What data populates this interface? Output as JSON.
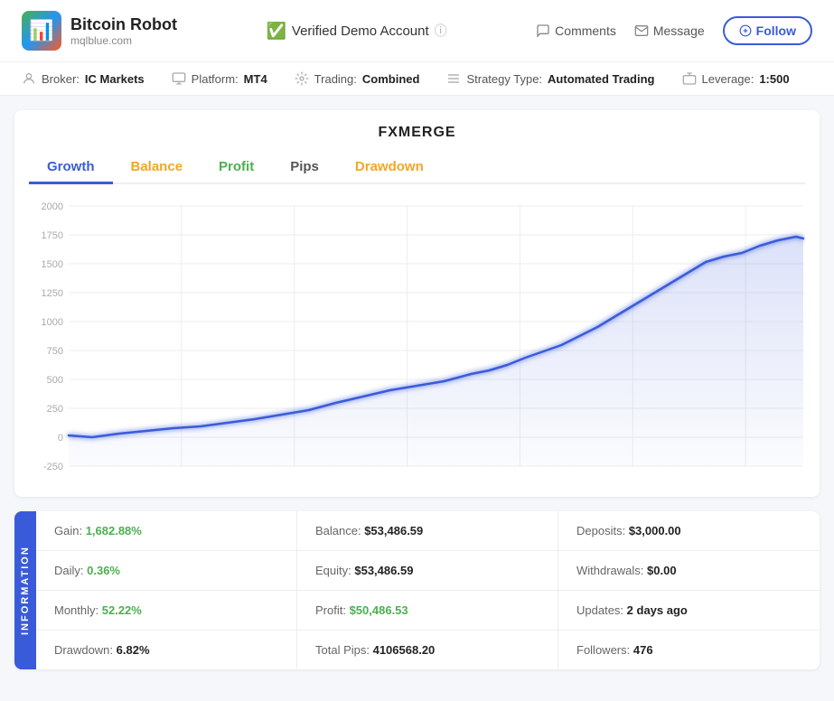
{
  "header": {
    "logo_icon": "📊",
    "logo_title": "Bitcoin Robot",
    "logo_subtitle": "mqlblue.com",
    "verified_label": "Verified Demo Account",
    "comments_label": "Comments",
    "message_label": "Message",
    "follow_label": "Follow"
  },
  "meta": {
    "broker_label": "Broker:",
    "broker_value": "IC Markets",
    "platform_label": "Platform:",
    "platform_value": "MT4",
    "trading_label": "Trading:",
    "trading_value": "Combined",
    "strategy_label": "Strategy Type:",
    "strategy_value": "Automated Trading",
    "leverage_label": "Leverage:",
    "leverage_value": "1:500"
  },
  "chart": {
    "title": "FXMERGE",
    "tabs": [
      {
        "id": "growth",
        "label": "Growth",
        "active": true
      },
      {
        "id": "balance",
        "label": "Balance"
      },
      {
        "id": "profit",
        "label": "Profit"
      },
      {
        "id": "pips",
        "label": "Pips"
      },
      {
        "id": "drawdown",
        "label": "Drawdown"
      }
    ],
    "y_labels": [
      "2000",
      "1750",
      "1500",
      "1250",
      "1000",
      "750",
      "500",
      "250",
      "0",
      "-250"
    ]
  },
  "stats": {
    "side_label": "INFORMATION",
    "rows": [
      [
        {
          "label": "Gain:",
          "value": "1,682.88%",
          "color": "green"
        },
        {
          "label": "Balance:",
          "value": "$53,486.59",
          "color": "neutral"
        },
        {
          "label": "Deposits:",
          "value": "$3,000.00",
          "color": "neutral"
        }
      ],
      [
        {
          "label": "Daily:",
          "value": "0.36%",
          "color": "green"
        },
        {
          "label": "Equity:",
          "value": "$53,486.59",
          "color": "neutral"
        },
        {
          "label": "Withdrawals:",
          "value": "$0.00",
          "color": "neutral"
        }
      ],
      [
        {
          "label": "Monthly:",
          "value": "52.22%",
          "color": "green"
        },
        {
          "label": "Profit:",
          "value": "$50,486.53",
          "color": "green"
        },
        {
          "label": "Updates:",
          "value": "2 days ago",
          "color": "neutral"
        }
      ],
      [
        {
          "label": "Drawdown:",
          "value": "6.82%",
          "color": "neutral"
        },
        {
          "label": "Total Pips:",
          "value": "4106568.20",
          "color": "neutral"
        },
        {
          "label": "Followers:",
          "value": "476",
          "color": "neutral"
        }
      ]
    ]
  }
}
